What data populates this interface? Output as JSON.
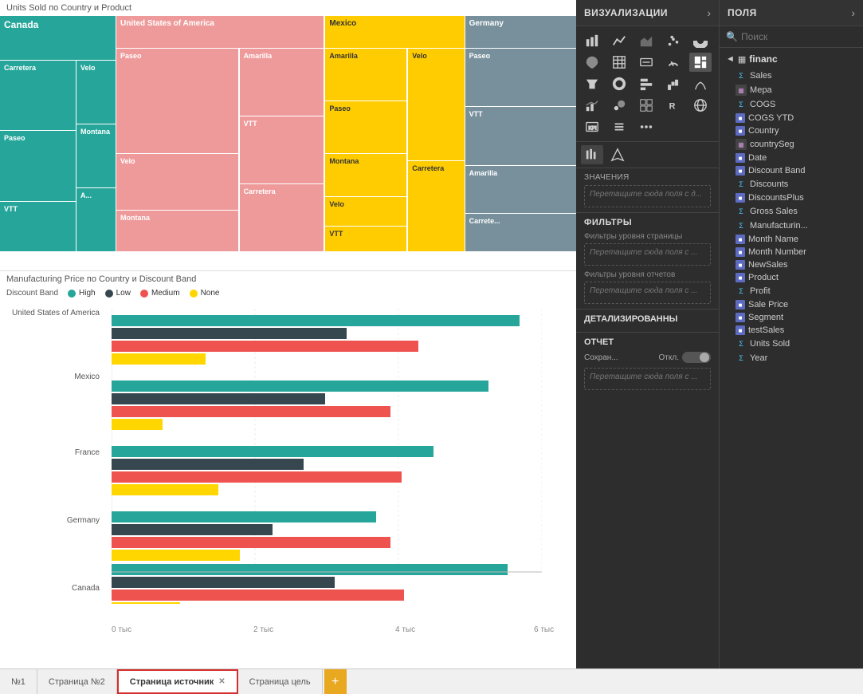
{
  "charts": {
    "treemap_title": "Units Sold по Country и Product",
    "barchart_title": "Manufacturing Price по Country и Discount Band",
    "legend_title": "Discount Band",
    "legend_items": [
      {
        "label": "High",
        "color": "#26a69a"
      },
      {
        "label": "Low",
        "color": "#37474f"
      },
      {
        "label": "Medium",
        "color": "#ef5350"
      },
      {
        "label": "None",
        "color": "#ffd600"
      }
    ],
    "countries": [
      {
        "name": "United States of America",
        "bars": [
          0.95,
          0.55,
          0.72,
          0.22
        ]
      },
      {
        "name": "Mexico",
        "bars": [
          0.88,
          0.5,
          0.65,
          0.12
        ]
      },
      {
        "name": "France",
        "bars": [
          0.75,
          0.45,
          0.68,
          0.25
        ]
      },
      {
        "name": "Germany",
        "bars": [
          0.62,
          0.38,
          0.65,
          0.3
        ]
      },
      {
        "name": "Canada",
        "bars": [
          0.92,
          0.52,
          0.68,
          0.16
        ]
      }
    ],
    "x_axis_labels": [
      "0 тыс",
      "2 тыс",
      "4 тыс",
      "6 тыс"
    ],
    "treemap_cells": {
      "canada": {
        "color": "#26a69a",
        "label": "Canada",
        "sub": [
          {
            "label": "Carretera",
            "color": "#26a69a"
          },
          {
            "label": "Paseo",
            "color": "#26a69a"
          },
          {
            "label": "Velo",
            "color": "#26a69a"
          },
          {
            "label": "VTT",
            "color": "#26a69a"
          },
          {
            "label": "Montana",
            "color": "#26a69a"
          },
          {
            "label": "A...",
            "color": "#26a69a"
          }
        ]
      }
    }
  },
  "viz_panel": {
    "title": "ВИЗУАЛИЗАЦИИ",
    "sections": {
      "values": "Значения",
      "values_drop": "Перетащите сюда поля с д...",
      "filters_title": "ФИЛЬТРЫ",
      "filter_page": "Фильтры уровня страницы",
      "filter_page_drop": "Перетащите сюда поля с ...",
      "filter_report": "Фильтры уровня отчетов",
      "filter_report_drop": "Перетащите сюда поля с ...",
      "detail_title": "ДЕТАЛИЗИРОВАННЫ",
      "report_title": "ОТЧЕТ",
      "report_save": "Сохран...",
      "report_toggle": "Откл.",
      "report_drop": "Перетащите сюда поля с ..."
    }
  },
  "fields_panel": {
    "title": "ПОЛЯ",
    "search_placeholder": "Поиск",
    "group": {
      "name": "financ",
      "items": [
        {
          "name": "Sales",
          "type": "sigma"
        },
        {
          "name": "Мера",
          "type": "table"
        },
        {
          "name": "COGS",
          "type": "sigma"
        },
        {
          "name": "COGS YTD",
          "type": "field"
        },
        {
          "name": "Country",
          "type": "field"
        },
        {
          "name": "countrySeg",
          "type": "table"
        },
        {
          "name": "Date",
          "type": "field"
        },
        {
          "name": "Discount Band",
          "type": "field"
        },
        {
          "name": "Discounts",
          "type": "sigma"
        },
        {
          "name": "DiscountsPlus",
          "type": "field"
        },
        {
          "name": "Gross Sales",
          "type": "sigma"
        },
        {
          "name": "Manufacturin...",
          "type": "sigma"
        },
        {
          "name": "Month Name",
          "type": "field"
        },
        {
          "name": "Month Number",
          "type": "field"
        },
        {
          "name": "NewSales",
          "type": "field"
        },
        {
          "name": "Product",
          "type": "field"
        },
        {
          "name": "Profit",
          "type": "sigma"
        },
        {
          "name": "Sale Price",
          "type": "field"
        },
        {
          "name": "Segment",
          "type": "field"
        },
        {
          "name": "testSales",
          "type": "field"
        },
        {
          "name": "Units Sold",
          "type": "sigma"
        },
        {
          "name": "Year",
          "type": "sigma"
        }
      ]
    }
  },
  "tabs": [
    {
      "label": "№1",
      "active": false
    },
    {
      "label": "Страница №2",
      "active": false
    },
    {
      "label": "Страница источник",
      "active": true,
      "selected": true
    },
    {
      "label": "Страница цель",
      "active": false
    }
  ],
  "tab_add": "+"
}
